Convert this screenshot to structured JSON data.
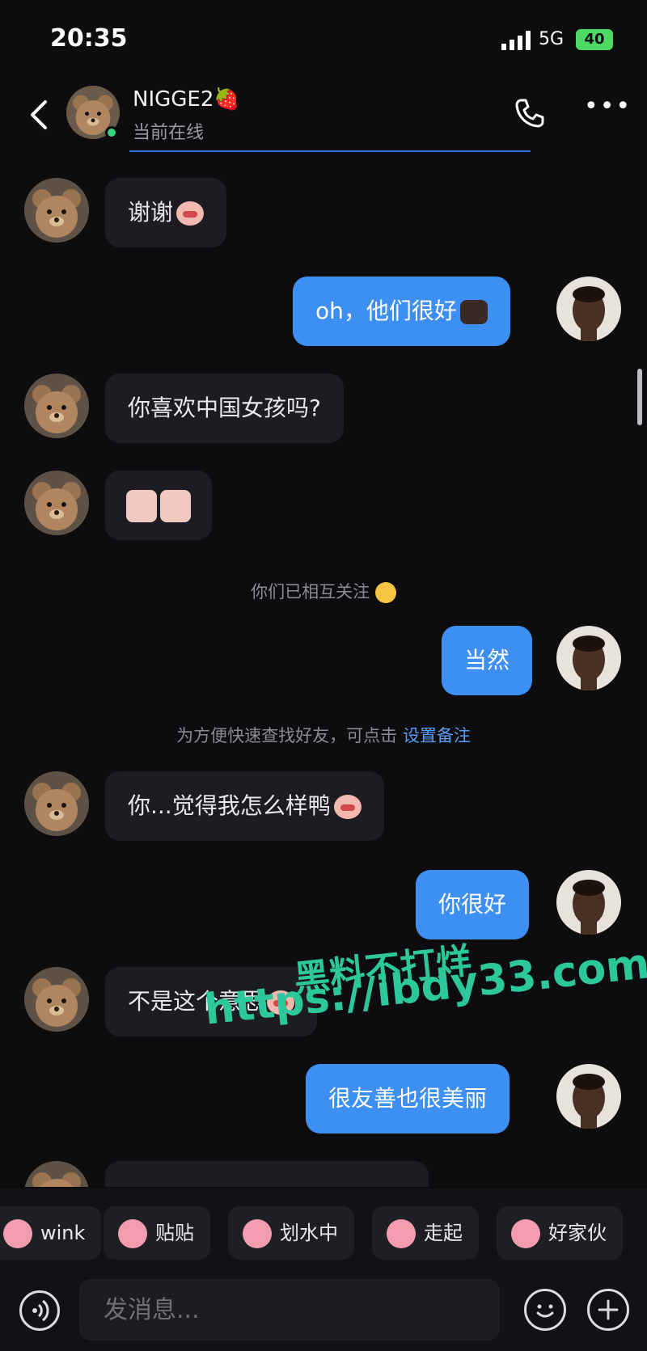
{
  "status_bar": {
    "time": "20:35",
    "network": "5G",
    "battery": "40"
  },
  "header": {
    "name": "NIGGE2🍓",
    "status": "当前在线",
    "back_icon": "chevron-left-icon",
    "call_icon": "phone-icon",
    "more_icon": "more-icon"
  },
  "messages": [
    {
      "side": "in",
      "text": "谢谢"
    },
    {
      "side": "out",
      "text": "oh，他们很好"
    },
    {
      "side": "in",
      "text": "你喜欢中国女孩吗?"
    },
    {
      "side": "in",
      "text": ""
    },
    {
      "side": "out",
      "text": "当然"
    },
    {
      "side": "in",
      "text": "你...觉得我怎么样鸭"
    },
    {
      "side": "out",
      "text": "你很好"
    },
    {
      "side": "in",
      "text": "不是这个意思"
    },
    {
      "side": "out",
      "text": "很友善也很美丽"
    }
  ],
  "system_notes": {
    "mutual_follow": "你们已相互关注",
    "remark_hint": "为方便快速查找好友，可点击",
    "remark_link": "设置备注"
  },
  "watermark": {
    "line1": "黑料不打烊",
    "line2": "https://ibdy33.com"
  },
  "quick_replies": [
    "wink",
    "贴贴",
    "划水中",
    "走起",
    "好家伙"
  ],
  "input": {
    "placeholder": "发消息..."
  },
  "colors": {
    "background": "#0d0d10",
    "outgoing_bubble": "#3d8ff4",
    "incoming_bubble": "#1c1c22",
    "online": "#3ad27a",
    "link": "#5a9bf5",
    "watermark": "#2cc79a"
  }
}
